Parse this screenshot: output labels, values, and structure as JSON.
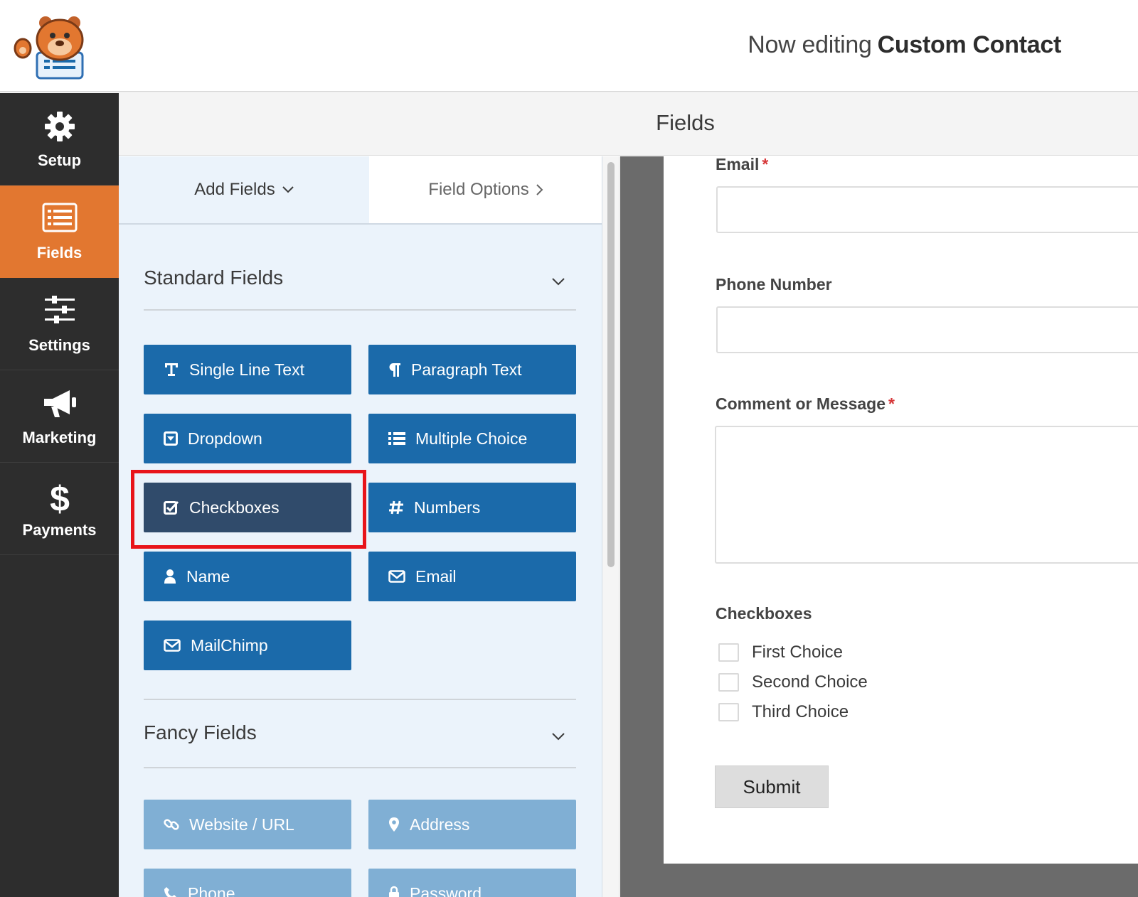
{
  "header": {
    "editing_prefix": "Now editing",
    "form_name": "Custom Contact"
  },
  "sidebar": {
    "items": [
      {
        "label": "Setup",
        "icon": "gear-icon"
      },
      {
        "label": "Fields",
        "icon": "fields-list-icon",
        "active": true
      },
      {
        "label": "Settings",
        "icon": "sliders-icon"
      },
      {
        "label": "Marketing",
        "icon": "megaphone-icon"
      },
      {
        "label": "Payments",
        "icon": "dollar-icon"
      }
    ]
  },
  "page_title": "Fields",
  "tabs": {
    "add_fields": "Add Fields",
    "field_options": "Field Options"
  },
  "standard_fields": {
    "title": "Standard Fields",
    "buttons": [
      {
        "label": "Single Line Text",
        "icon": "text-icon"
      },
      {
        "label": "Paragraph Text",
        "icon": "paragraph-icon"
      },
      {
        "label": "Dropdown",
        "icon": "dropdown-icon"
      },
      {
        "label": "Multiple Choice",
        "icon": "list-icon"
      },
      {
        "label": "Checkboxes",
        "icon": "checkbox-icon",
        "selected": true
      },
      {
        "label": "Numbers",
        "icon": "hash-icon"
      },
      {
        "label": "Name",
        "icon": "user-icon"
      },
      {
        "label": "Email",
        "icon": "envelope-icon"
      },
      {
        "label": "MailChimp",
        "icon": "envelope-icon"
      }
    ]
  },
  "fancy_fields": {
    "title": "Fancy Fields",
    "buttons": [
      {
        "label": "Website / URL",
        "icon": "link-icon"
      },
      {
        "label": "Address",
        "icon": "map-pin-icon"
      },
      {
        "label": "Phone",
        "icon": "phone-icon"
      },
      {
        "label": "Password",
        "icon": "lock-icon"
      }
    ]
  },
  "preview": {
    "email_label": "Email",
    "phone_label": "Phone Number",
    "comment_label": "Comment or Message",
    "required_mark": "*",
    "checkboxes_label": "Checkboxes",
    "choices": [
      "First Choice",
      "Second Choice",
      "Third Choice"
    ],
    "submit_label": "Submit"
  },
  "colors": {
    "accent_orange": "#e27730",
    "button_blue": "#1b6aaa",
    "button_selected": "#304b6b",
    "button_fancy": "#80afd4",
    "highlight_red": "#e8141a",
    "sidebar_dark": "#2d2d2d"
  }
}
